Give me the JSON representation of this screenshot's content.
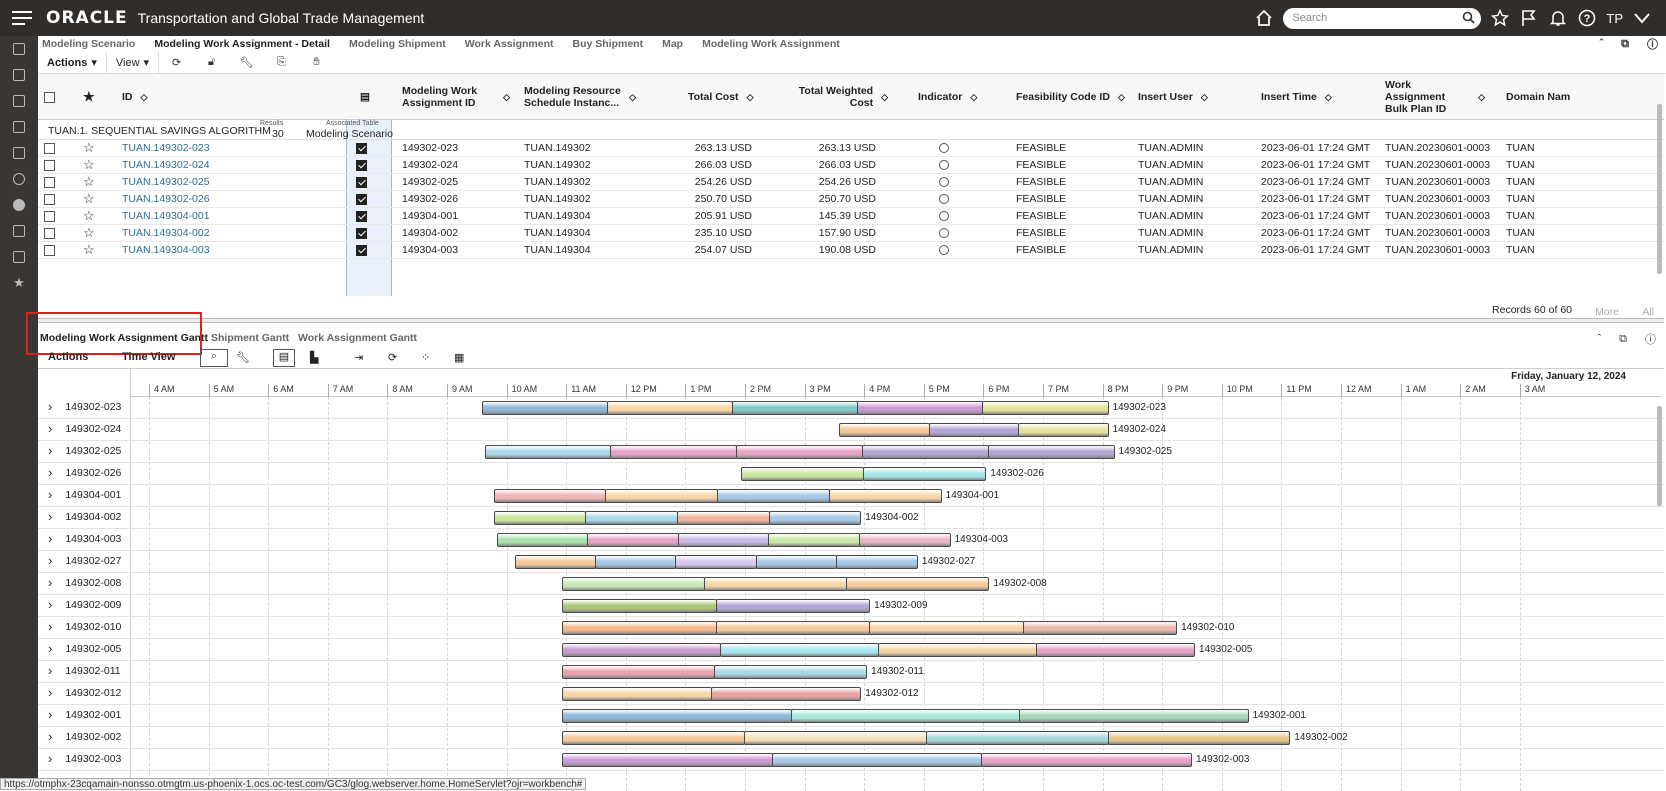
{
  "header": {
    "brand": "ORACLE",
    "app_title": "Transportation and Global Trade Management",
    "search_placeholder": "Search",
    "user_initials": "TP"
  },
  "tabs": [
    {
      "label": "Modeling Scenario"
    },
    {
      "label": "Modeling Work Assignment - Detail",
      "active": true
    },
    {
      "label": "Modeling Shipment"
    },
    {
      "label": "Work Assignment"
    },
    {
      "label": "Buy Shipment"
    },
    {
      "label": "Map"
    },
    {
      "label": "Modeling Work Assignment"
    }
  ],
  "toolbar": {
    "actions": "Actions",
    "view": "View"
  },
  "grid": {
    "columns": [
      "ID",
      "Modeling Work Assignment ID",
      "Modeling Resource Schedule Instanc...",
      "Total Cost",
      "Total Weighted Cost",
      "Indicator",
      "Feasibility Code ID",
      "Insert User",
      "Insert Time",
      "Work Assignment Bulk Plan ID",
      "Domain Nam"
    ],
    "group": {
      "label": "TUAN.1. SEQUENTIAL SAVINGS ALGORITHM",
      "results_label": "Results",
      "results_value": "30",
      "assoc_label": "Associated Table",
      "assoc_value": "Modeling Scenario"
    },
    "rows": [
      {
        "id": "TUAN.149302-023",
        "mwa": "149302-023",
        "res": "TUAN.149302",
        "cost": "263.13 USD",
        "wcost": "263.13 USD",
        "feas": "FEASIBLE",
        "user": "TUAN.ADMIN",
        "time": "2023-06-01 17:24 GMT",
        "bulk": "TUAN.20230601-0003",
        "domain": "TUAN"
      },
      {
        "id": "TUAN.149302-024",
        "mwa": "149302-024",
        "res": "TUAN.149302",
        "cost": "266.03 USD",
        "wcost": "266.03 USD",
        "feas": "FEASIBLE",
        "user": "TUAN.ADMIN",
        "time": "2023-06-01 17:24 GMT",
        "bulk": "TUAN.20230601-0003",
        "domain": "TUAN"
      },
      {
        "id": "TUAN.149302-025",
        "mwa": "149302-025",
        "res": "TUAN.149302",
        "cost": "254.26 USD",
        "wcost": "254.26 USD",
        "feas": "FEASIBLE",
        "user": "TUAN.ADMIN",
        "time": "2023-06-01 17:24 GMT",
        "bulk": "TUAN.20230601-0003",
        "domain": "TUAN"
      },
      {
        "id": "TUAN.149302-026",
        "mwa": "149302-026",
        "res": "TUAN.149302",
        "cost": "250.70 USD",
        "wcost": "250.70 USD",
        "feas": "FEASIBLE",
        "user": "TUAN.ADMIN",
        "time": "2023-06-01 17:24 GMT",
        "bulk": "TUAN.20230601-0003",
        "domain": "TUAN"
      },
      {
        "id": "TUAN.149304-001",
        "mwa": "149304-001",
        "res": "TUAN.149304",
        "cost": "205.91 USD",
        "wcost": "145.39 USD",
        "feas": "FEASIBLE",
        "user": "TUAN.ADMIN",
        "time": "2023-06-01 17:24 GMT",
        "bulk": "TUAN.20230601-0003",
        "domain": "TUAN"
      },
      {
        "id": "TUAN.149304-002",
        "mwa": "149304-002",
        "res": "TUAN.149304",
        "cost": "235.10 USD",
        "wcost": "157.90 USD",
        "feas": "FEASIBLE",
        "user": "TUAN.ADMIN",
        "time": "2023-06-01 17:24 GMT",
        "bulk": "TUAN.20230601-0003",
        "domain": "TUAN"
      },
      {
        "id": "TUAN.149304-003",
        "mwa": "149304-003",
        "res": "TUAN.149304",
        "cost": "254.07 USD",
        "wcost": "190.08 USD",
        "feas": "FEASIBLE",
        "user": "TUAN.ADMIN",
        "time": "2023-06-01 17:24 GMT",
        "bulk": "TUAN.20230601-0003",
        "domain": "TUAN"
      }
    ],
    "records": "Records 60 of 60",
    "more": "More",
    "all": "All"
  },
  "gantt": {
    "tabs": [
      "Modeling Work Assignment Gantt",
      "Shipment Gantt",
      "Work Assignment Gantt"
    ],
    "actions": "Actions",
    "time_view": "Time View",
    "date_label": "Friday, January 12, 2024",
    "hours": [
      "4 AM",
      "5 AM",
      "6 AM",
      "7 AM",
      "8 AM",
      "9 AM",
      "10 AM",
      "11 AM",
      "12 PM",
      "1 PM",
      "2 PM",
      "3 PM",
      "4 PM",
      "5 PM",
      "6 PM",
      "7 PM",
      "8 PM",
      "9 PM",
      "10 PM",
      "11 PM",
      "12 AM",
      "1 AM",
      "2 AM",
      "3 AM"
    ],
    "rows": [
      {
        "label": "149302-023",
        "start": 9.6,
        "end": 20.1,
        "colors": [
          "#8fb8d8",
          "#f6d6a8",
          "#7fc7c9",
          "#c99bd3",
          "#e8e39c"
        ]
      },
      {
        "label": "149302-024",
        "start": 15.6,
        "end": 20.1,
        "colors": [
          "#f6c99a",
          "#b4a7d6",
          "#e8e39c"
        ]
      },
      {
        "label": "149302-025",
        "start": 9.65,
        "end": 20.2,
        "colors": [
          "#a8d8ea",
          "#e8a2c7",
          "#e8a2c7",
          "#b4a7d6",
          "#b4a7d6"
        ]
      },
      {
        "label": "149302-026",
        "start": 13.95,
        "end": 18.05,
        "colors": [
          "#c9e8a0",
          "#a8e8ea"
        ]
      },
      {
        "label": "149304-001",
        "start": 9.8,
        "end": 17.3,
        "colors": [
          "#f0b5b5",
          "#f6d6a8",
          "#a8c8e8",
          "#f6d6a8"
        ]
      },
      {
        "label": "149304-002",
        "start": 9.8,
        "end": 15.95,
        "colors": [
          "#c9e89c",
          "#a8d8ea",
          "#f0b59a",
          "#a8c8e8"
        ]
      },
      {
        "label": "149304-003",
        "start": 9.85,
        "end": 17.45,
        "colors": [
          "#a8e0a8",
          "#e8a2c7",
          "#c9b8e8",
          "#c8e8a8",
          "#e8b8c8"
        ]
      },
      {
        "label": "149302-027",
        "start": 10.15,
        "end": 16.9,
        "colors": [
          "#f6c99a",
          "#a8c8e8",
          "#d8c8f0",
          "#a8c8e8",
          "#a8c8e8"
        ]
      },
      {
        "label": "149302-008",
        "start": 10.95,
        "end": 18.1,
        "colors": [
          "#c9e8b8",
          "#f6d6a8",
          "#f6c99a"
        ]
      },
      {
        "label": "149302-009",
        "start": 10.95,
        "end": 16.1,
        "colors": [
          "#a8c878",
          "#b4a7d6"
        ]
      },
      {
        "label": "149302-010",
        "start": 10.95,
        "end": 21.25,
        "colors": [
          "#f6b98a",
          "#f6c99a",
          "#f6d6a8",
          "#e8b8a8"
        ]
      },
      {
        "label": "149302-005",
        "start": 10.95,
        "end": 21.55,
        "colors": [
          "#c99bd3",
          "#a8e8f0",
          "#f6d6a8",
          "#e8a2c7"
        ]
      },
      {
        "label": "149302-011",
        "start": 10.95,
        "end": 16.05,
        "colors": [
          "#e8a2b0",
          "#a8d8ea"
        ]
      },
      {
        "label": "149302-012",
        "start": 10.95,
        "end": 15.95,
        "colors": [
          "#f6d6a8",
          "#e8a2a2"
        ]
      },
      {
        "label": "149302-001",
        "start": 10.95,
        "end": 22.45,
        "colors": [
          "#8fb8d8",
          "#a8e8d8",
          "#a8d8b8"
        ]
      },
      {
        "label": "149302-002",
        "start": 10.95,
        "end": 23.15,
        "colors": [
          "#f6c99a",
          "#f6e0b8",
          "#a8d8d8",
          "#e8c88a"
        ]
      },
      {
        "label": "149302-003",
        "start": 10.95,
        "end": 21.5,
        "colors": [
          "#c99bd3",
          "#a8c8e8",
          "#e8a2c7"
        ]
      }
    ]
  },
  "status_url": "https://otmphx-23cqamain-nonsso.otmgtm.us-phoenix-1.ocs.oc-test.com/GC3/glog.webserver.home.HomeServlet?ojr=workbench#"
}
